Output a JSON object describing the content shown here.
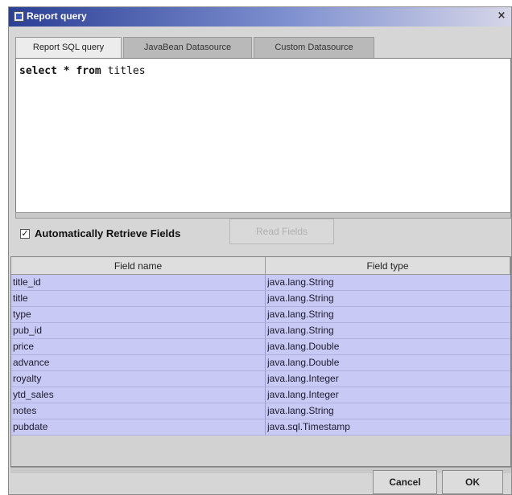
{
  "window": {
    "title": "Report query",
    "close_glyph": "×"
  },
  "tabs": [
    {
      "label": "Report SQL query",
      "active": true
    },
    {
      "label": "JavaBean Datasource",
      "active": false
    },
    {
      "label": "Custom Datasource",
      "active": false
    }
  ],
  "sql": {
    "keyword1": "select",
    "op": "*",
    "keyword2": "from",
    "table": "titles"
  },
  "auto_retrieve": {
    "checked": true,
    "label": "Automatically Retrieve Fields"
  },
  "read_fields_button": {
    "label": "Read Fields",
    "enabled": false
  },
  "fields_table": {
    "headers": [
      "Field name",
      "Field type"
    ],
    "rows": [
      {
        "name": "title_id",
        "type": "java.lang.String"
      },
      {
        "name": "title",
        "type": "java.lang.String"
      },
      {
        "name": "type",
        "type": "java.lang.String"
      },
      {
        "name": "pub_id",
        "type": "java.lang.String"
      },
      {
        "name": "price",
        "type": "java.lang.Double"
      },
      {
        "name": "advance",
        "type": "java.lang.Double"
      },
      {
        "name": "royalty",
        "type": "java.lang.Integer"
      },
      {
        "name": "ytd_sales",
        "type": "java.lang.Integer"
      },
      {
        "name": "notes",
        "type": "java.lang.String"
      },
      {
        "name": "pubdate",
        "type": "java.sql.Timestamp"
      }
    ]
  },
  "buttons": {
    "cancel": "Cancel",
    "ok": "OK"
  },
  "colors": {
    "titlebar": "#2b3f95",
    "row_highlight": "#c9c9f5",
    "dialog_bg": "#d6d6d6"
  },
  "icons": {
    "window": "report-window-icon",
    "close": "close-icon",
    "check": "check-icon"
  }
}
